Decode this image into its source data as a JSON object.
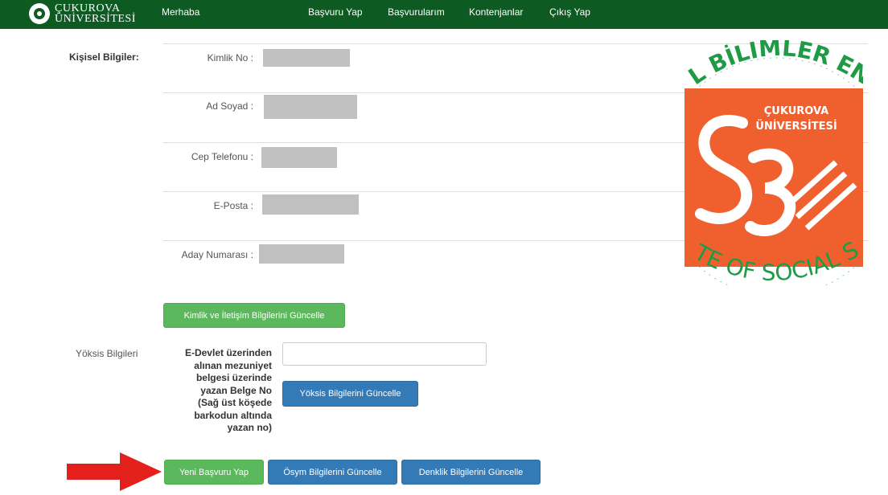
{
  "navbar": {
    "brand_line1": "ÇUKUROVA",
    "brand_line2": "ÜNİVERSİTESİ",
    "greeting": "Merhaba",
    "items": [
      "Başvuru Yap",
      "Başvurularım",
      "Kontenjanlar",
      "Çıkış Yap"
    ],
    "bg_color": "#0e5a23"
  },
  "personal": {
    "section_label": "Kişisel Bilgiler:",
    "fields": [
      {
        "label": "Kimlik No :"
      },
      {
        "label": "Ad Soyad :"
      },
      {
        "label": "Cep Telefonu :"
      },
      {
        "label": "E-Posta :"
      },
      {
        "label": "Aday Numarası :"
      }
    ],
    "update_button": "Kimlik ve İletişim Bilgilerini Güncelle"
  },
  "emblem": {
    "university_line1": "ÇUKUROVA",
    "university_line2": "ÜNİVERSİTESİ",
    "arc_top": "L BİLİMLER ENS",
    "arc_bottom": "TE OF SOCIAL SCI",
    "orange": "#f0602e",
    "green": "#1f9b46"
  },
  "yoksis": {
    "section_label": "Yöksis Bilgileri",
    "belge_lines": [
      "E-Devlet üzerinden",
      "alınan mezuniyet",
      "belgesi üzerinde",
      "yazan Belge No",
      "(Sağ üst köşede",
      "barkodun altında",
      "yazan no)"
    ],
    "belge_input_value": "",
    "update_button": "Yöksis Bilgilerini Güncelle"
  },
  "actions": {
    "new_application": "Yeni Başvuru Yap",
    "osym_update": "Ösym Bilgilerini Güncelle",
    "denklik_update": "Denklik Bilgilerini Güncelle"
  },
  "colors": {
    "btn_green": "#5cb85c",
    "btn_blue": "#337ab7",
    "arrow_red": "#e3201b"
  }
}
